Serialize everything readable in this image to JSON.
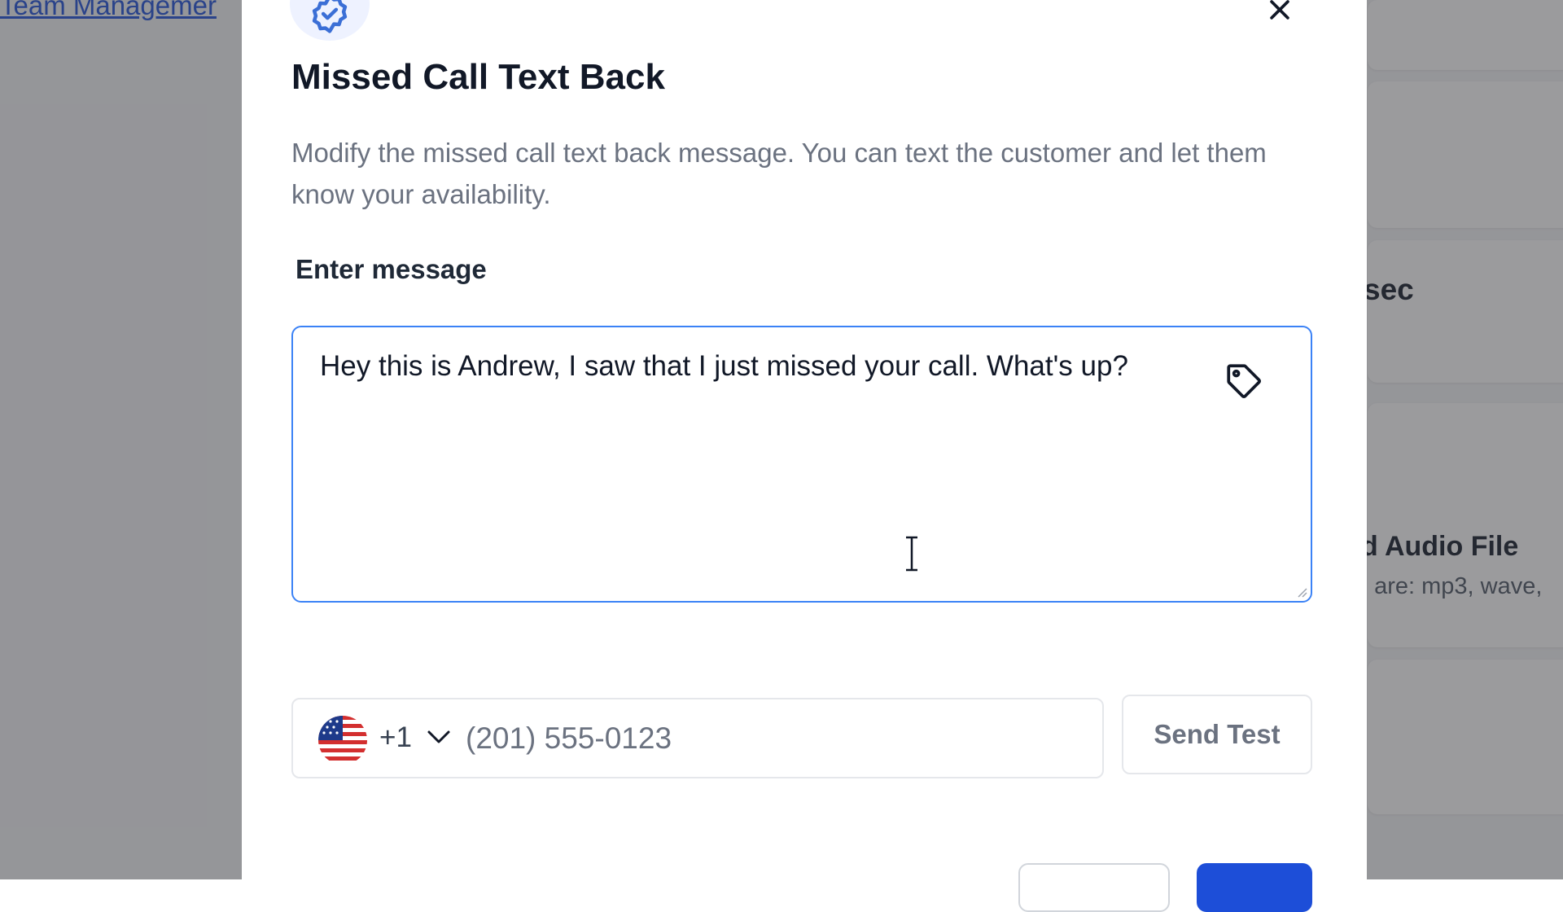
{
  "background": {
    "link_text": "Team Managemer",
    "text_sec": "sec",
    "text_audio": "d Audio File",
    "text_formats": ". are: mp3, wave,"
  },
  "modal": {
    "title": "Missed Call Text Back",
    "description": "Modify the missed call text back message. You can text the customer and let them know your availability.",
    "field_label": "Enter message",
    "message": "Hey this is Andrew, I saw that I just missed your call. What's up?",
    "country_code": "+1",
    "phone_placeholder": "(201) 555-0123",
    "send_test_label": "Send Test"
  },
  "icons": {
    "header": "check-badge-icon",
    "close": "close-icon",
    "tag": "tag-icon",
    "flag": "us-flag-icon",
    "chevron": "chevron-down-icon"
  },
  "colors": {
    "accent": "#3b82f6",
    "primary_button": "#1d4ed8",
    "overlay": "#37373c"
  }
}
